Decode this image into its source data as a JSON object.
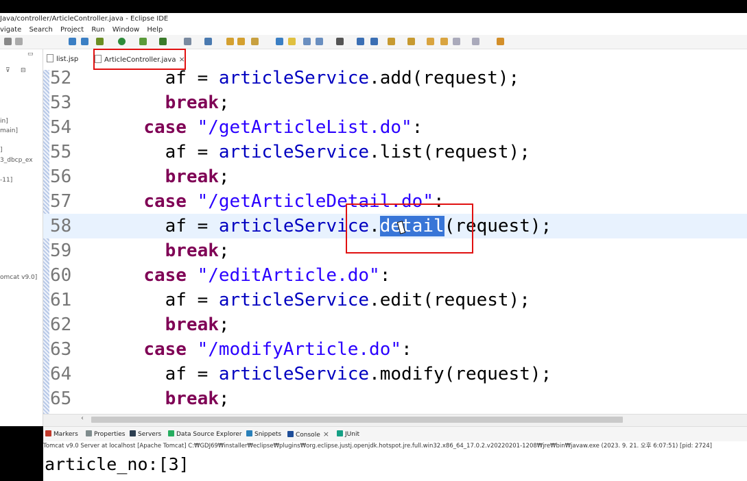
{
  "window": {
    "title": "Java/controller/ArticleController.java - Eclipse IDE"
  },
  "menu": [
    "vigate",
    "Search",
    "Project",
    "Run",
    "Window",
    "Help"
  ],
  "left_panel": {
    "rows": [
      "in]",
      "main]",
      "]",
      "3_dbcp_ex",
      "-11]",
      "omcat v9.0]"
    ]
  },
  "tabs": [
    {
      "label": "list.jsp"
    },
    {
      "label": "ArticleController.java",
      "close": "×"
    }
  ],
  "editor": {
    "lines": [
      {
        "n": "52",
        "indent": "    ",
        "parts": [
          [
            "",
            "af = "
          ],
          [
            "fld",
            "articleService"
          ],
          [
            "",
            ".add(request);"
          ]
        ]
      },
      {
        "n": "53",
        "indent": "    ",
        "parts": [
          [
            "kw",
            "break"
          ],
          [
            "",
            ";"
          ]
        ]
      },
      {
        "n": "54",
        "indent": "  ",
        "parts": [
          [
            "kw",
            "case"
          ],
          [
            "",
            " "
          ],
          [
            "str",
            "\"/getArticleList.do\""
          ],
          [
            "",
            ":"
          ]
        ]
      },
      {
        "n": "55",
        "indent": "    ",
        "parts": [
          [
            "",
            "af = "
          ],
          [
            "fld",
            "articleService"
          ],
          [
            "",
            ".list(request);"
          ]
        ]
      },
      {
        "n": "56",
        "indent": "    ",
        "parts": [
          [
            "kw",
            "break"
          ],
          [
            "",
            ";"
          ]
        ]
      },
      {
        "n": "57",
        "indent": "  ",
        "parts": [
          [
            "kw",
            "case"
          ],
          [
            "",
            " "
          ],
          [
            "str",
            "\"/getArticleDetail.do\""
          ],
          [
            "",
            ":"
          ]
        ]
      },
      {
        "n": "58",
        "indent": "    ",
        "current": true,
        "parts": [
          [
            "",
            "af = "
          ],
          [
            "fld",
            "articleService"
          ],
          [
            "",
            "."
          ],
          [
            "sel",
            "detail"
          ],
          [
            "",
            "(request);"
          ]
        ]
      },
      {
        "n": "59",
        "indent": "    ",
        "parts": [
          [
            "kw",
            "break"
          ],
          [
            "",
            ";"
          ]
        ]
      },
      {
        "n": "60",
        "indent": "  ",
        "parts": [
          [
            "kw",
            "case"
          ],
          [
            "",
            " "
          ],
          [
            "str",
            "\"/editArticle.do\""
          ],
          [
            "",
            ":"
          ]
        ]
      },
      {
        "n": "61",
        "indent": "    ",
        "parts": [
          [
            "",
            "af = "
          ],
          [
            "fld",
            "articleService"
          ],
          [
            "",
            ".edit(request);"
          ]
        ]
      },
      {
        "n": "62",
        "indent": "    ",
        "parts": [
          [
            "kw",
            "break"
          ],
          [
            "",
            ";"
          ]
        ]
      },
      {
        "n": "63",
        "indent": "  ",
        "parts": [
          [
            "kw",
            "case"
          ],
          [
            "",
            " "
          ],
          [
            "str",
            "\"/modifyArticle.do\""
          ],
          [
            "",
            ":"
          ]
        ]
      },
      {
        "n": "64",
        "indent": "    ",
        "parts": [
          [
            "",
            "af = "
          ],
          [
            "fld",
            "articleService"
          ],
          [
            "",
            ".modify(request);"
          ]
        ]
      },
      {
        "n": "65",
        "indent": "    ",
        "parts": [
          [
            "kw",
            "break"
          ],
          [
            "",
            ";"
          ]
        ]
      }
    ]
  },
  "bottom_tabs": [
    {
      "label": "Markers",
      "color": "#c0392b"
    },
    {
      "label": "Properties",
      "color": "#7f8c8d"
    },
    {
      "label": "Servers",
      "color": "#2c3e50"
    },
    {
      "label": "Data Source Explorer",
      "color": "#27ae60"
    },
    {
      "label": "Snippets",
      "color": "#2980b9"
    },
    {
      "label": "Console",
      "color": "#1f4e99",
      "close": "×"
    },
    {
      "label": "JUnit",
      "color": "#16a085"
    }
  ],
  "console": {
    "header": "Tomcat v9.0 Server at localhost [Apache Tomcat] C:₩GDJ69₩installer₩eclipse₩plugins₩org.eclipse.justj.openjdk.hotspot.jre.full.win32.x86_64_17.0.2.v20220201-1208₩jre₩bin₩javaw.exe  (2023. 9. 21. 오후 6:07:51) [pid: 2724]",
    "output": "article_no:[3]"
  }
}
